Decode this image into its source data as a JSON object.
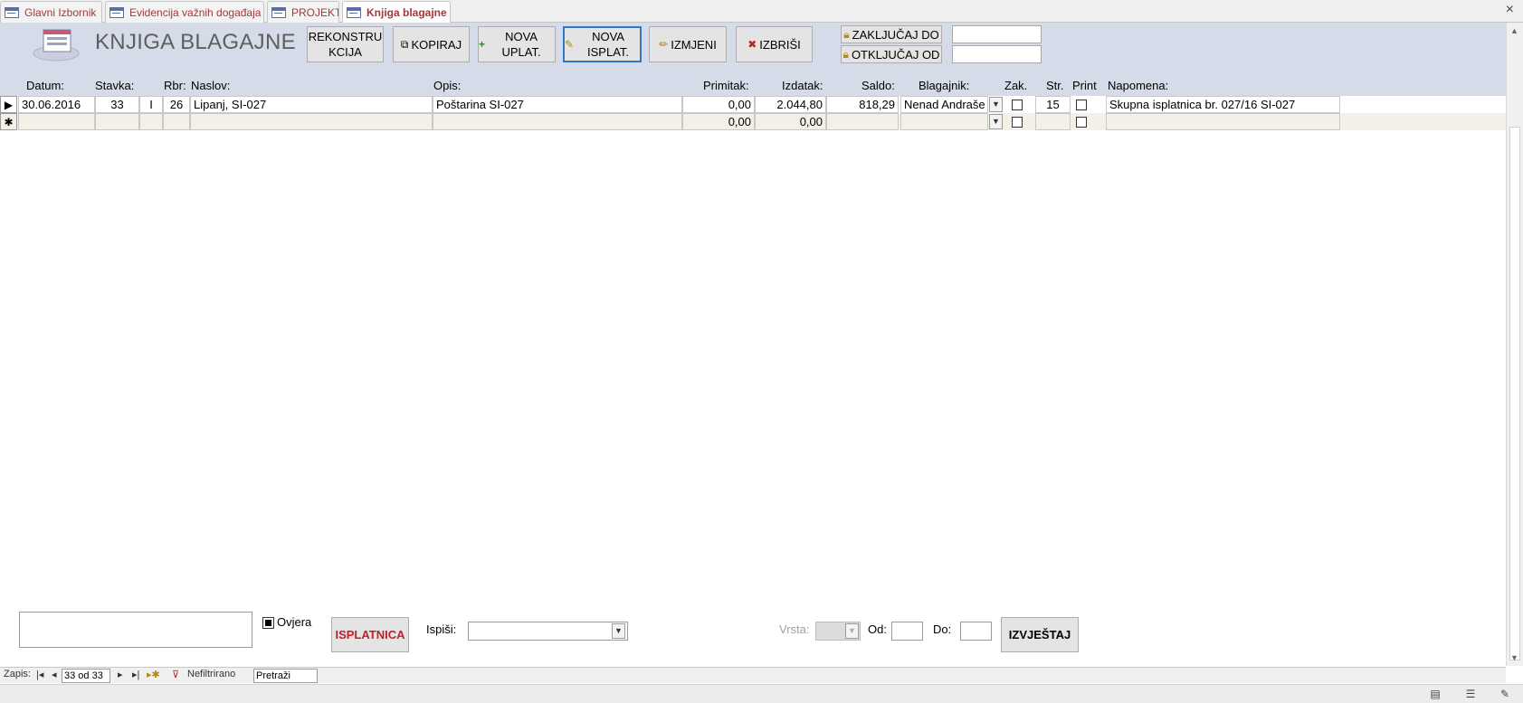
{
  "tabs": [
    {
      "label": "Glavni Izbornik"
    },
    {
      "label": "Evidencija važnih događaja"
    },
    {
      "label": "PROJEKTI"
    },
    {
      "label": "Knjiga blagajne"
    }
  ],
  "close_label": "×",
  "form": {
    "title": "KNJIGA BLAGAJNE",
    "buttons": {
      "rekonstrukcija": "REKONSTRU KCIJA",
      "kopiraj": "KOPIRAJ",
      "nova_uplata": "NOVA UPLAT.",
      "nova_isplata": "NOVA ISPLAT.",
      "izmjeni": "IZMJENI",
      "izbrisi": "IZBRIŠI",
      "zakljucaj": "ZAKLJUČAJ DO",
      "otkljucaj": "OTKLJUČAJ OD"
    },
    "zakljucaj_value": "",
    "otkljucaj_value": ""
  },
  "columns": {
    "datum": "Datum:",
    "stavka": "Stavka:",
    "rbr": "Rbr:",
    "naslov": "Naslov:",
    "opis": "Opis:",
    "primitak": "Primitak:",
    "izdatak": "Izdatak:",
    "saldo": "Saldo:",
    "blagajnik": "Blagajnik:",
    "zak": "Zak.",
    "str": "Str.",
    "print": "Print",
    "napomena": "Napomena:"
  },
  "rows": [
    {
      "selector": "▶",
      "datum": "30.06.2016",
      "stavka": "33",
      "tip": "I",
      "rbr": "26",
      "naslov": "Lipanj, SI-027",
      "opis": "Poštarina SI-027",
      "primitak": "0,00",
      "izdatak": "2.044,80",
      "saldo": "818,29",
      "blagajnik": "Nenad Andraše",
      "str": "15",
      "napomena": "Skupna isplatnica br. 027/16 SI-027"
    },
    {
      "selector": "✱",
      "datum": "",
      "stavka": "",
      "tip": "",
      "rbr": "",
      "naslov": "",
      "opis": "",
      "primitak": "0,00",
      "izdatak": "0,00",
      "saldo": "",
      "blagajnik": "",
      "str": "",
      "napomena": ""
    }
  ],
  "footer": {
    "ovjera_label": "Ovjera",
    "isplatnica_label": "ISPLATNICA",
    "ispisi_label": "Ispiši:",
    "ispisi_value": "",
    "vrsta_label": "Vrsta:",
    "od_label": "Od:",
    "do_label": "Do:",
    "izvjestaj_label": "IZVJEŠTAJ",
    "isplatnica_color": "#c0202a"
  },
  "navbar": {
    "zapis_label": "Zapis:",
    "record_position": "33 od 33",
    "filter_label": "Nefiltrirano",
    "search_placeholder": "Pretraži"
  },
  "colors": {
    "header_bg": "#d6dbe9",
    "tab_text": "#a4373a",
    "new_row_bg": "#f3f1e7"
  }
}
